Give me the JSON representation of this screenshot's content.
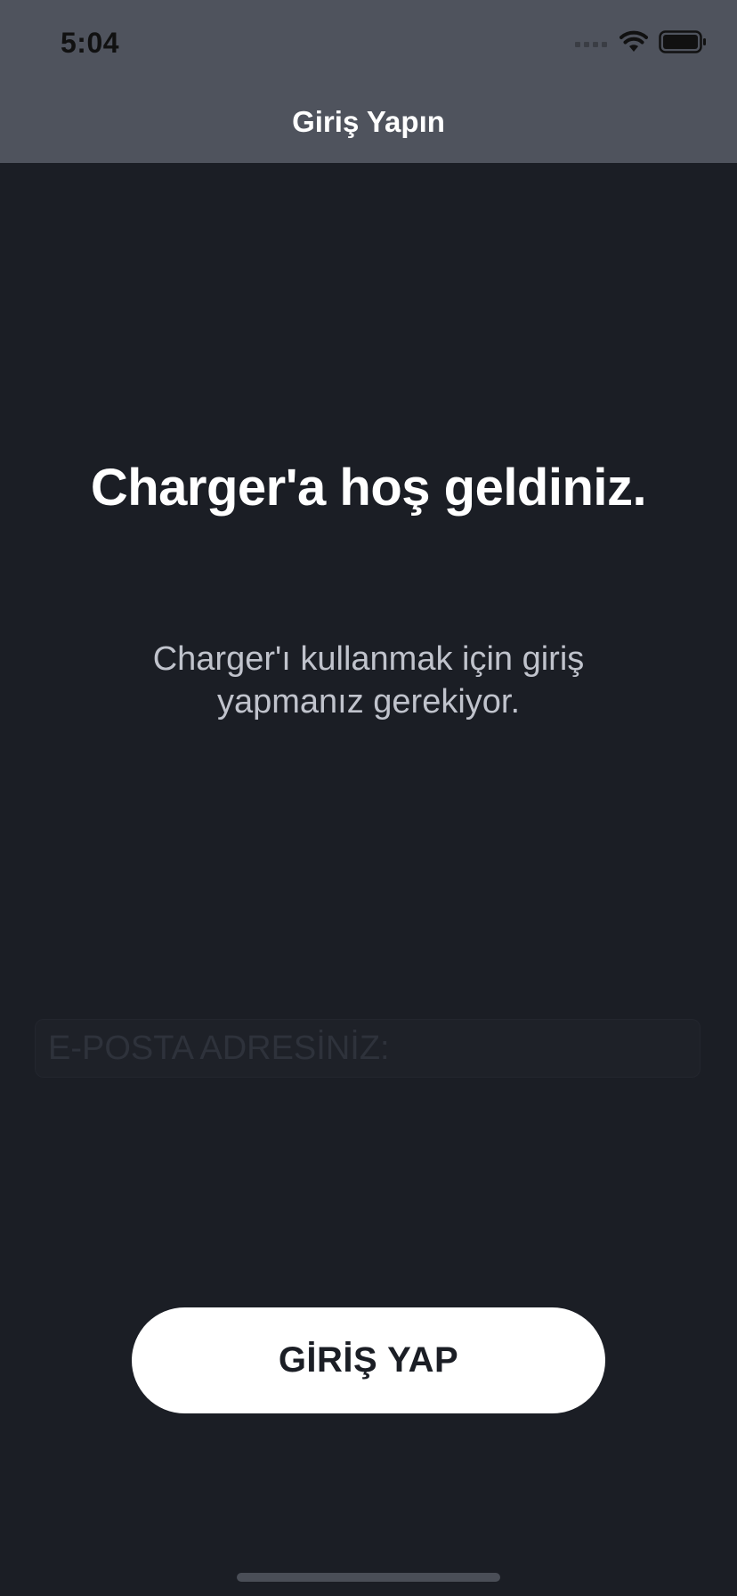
{
  "status_bar": {
    "time": "5:04",
    "icons": [
      "signal-icon",
      "wifi-icon",
      "battery-icon"
    ]
  },
  "nav": {
    "title": "Giriş Yapın"
  },
  "welcome": {
    "title": "Charger'a hoş geldiniz.",
    "subtitle": "Charger'ı kullanmak için giriş yapmanız gerekiyor."
  },
  "form": {
    "email_placeholder": "E-POSTA ADRESİNİZ:",
    "email_value": ""
  },
  "actions": {
    "login_label": "GİRİŞ YAP"
  },
  "colors": {
    "background": "#1b1e25",
    "header": "#4f535d",
    "button": "#ffffff",
    "button_text": "#1b1e25",
    "subtitle_text": "#c0c3cc"
  }
}
